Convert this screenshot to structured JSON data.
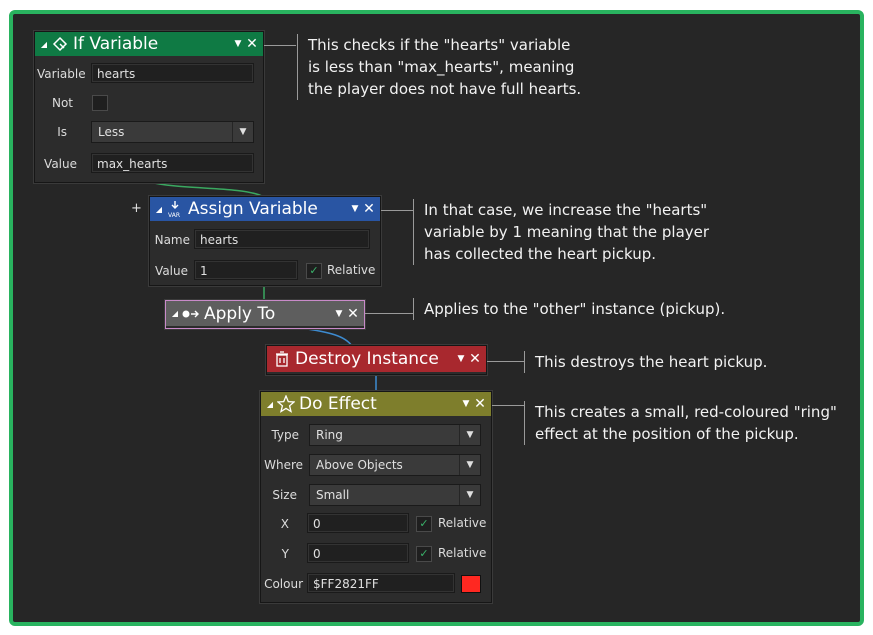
{
  "blocks": {
    "if_variable": {
      "title": "If Variable",
      "header_color": "#0f7a44",
      "fields": {
        "variable": {
          "label": "Variable",
          "value": "hearts"
        },
        "not": {
          "label": "Not",
          "checked": false
        },
        "is": {
          "label": "Is",
          "value": "Less"
        },
        "value": {
          "label": "Value",
          "value": "max_hearts"
        }
      }
    },
    "assign_variable": {
      "title": "Assign Variable",
      "header_color": "#2955a3",
      "fields": {
        "name": {
          "label": "Name",
          "value": "hearts"
        },
        "value": {
          "label": "Value",
          "value": "1"
        },
        "relative": {
          "label": "Relative",
          "checked": true
        }
      }
    },
    "apply_to": {
      "title": "Apply To",
      "header_color": "#5e5e5e",
      "border_color": "#c98ac9"
    },
    "destroy_instance": {
      "title": "Destroy Instance",
      "header_color": "#a8282e"
    },
    "do_effect": {
      "title": "Do Effect",
      "header_color": "#7e7e2c",
      "fields": {
        "type": {
          "label": "Type",
          "value": "Ring"
        },
        "where": {
          "label": "Where",
          "value": "Above Objects"
        },
        "size": {
          "label": "Size",
          "value": "Small"
        },
        "x": {
          "label": "X",
          "value": "0",
          "relative_label": "Relative",
          "relative": true
        },
        "y": {
          "label": "Y",
          "value": "0",
          "relative_label": "Relative",
          "relative": true
        },
        "colour": {
          "label": "Colour",
          "value": "$FF2821FF",
          "swatch": "#ff2821"
        }
      }
    }
  },
  "notes": {
    "if_variable": [
      "This checks if the \"hearts\" variable",
      "is less than \"max_hearts\", meaning",
      "the player does not have full hearts."
    ],
    "assign_variable": [
      "In that case, we increase the \"hearts\"",
      "variable by 1 meaning that the player",
      "has collected the heart pickup."
    ],
    "apply_to": [
      "Applies to the \"other\" instance (pickup)."
    ],
    "destroy_instance": [
      "This destroys the heart pickup."
    ],
    "do_effect": [
      "This creates a small, red-coloured \"ring\"",
      "effect at the position of the pickup."
    ]
  },
  "glyphs": {
    "collapse": "◢",
    "dropdown": "▼",
    "close": "✕",
    "check": "✓",
    "plus": "+"
  },
  "icons": {
    "if_variable": "branch-icon",
    "assign_variable": "var-arrow-icon",
    "apply_to": "apply-arrow-icon",
    "destroy_instance": "trash-icon",
    "do_effect": "star-icon"
  },
  "frame_color": "#29b35f"
}
